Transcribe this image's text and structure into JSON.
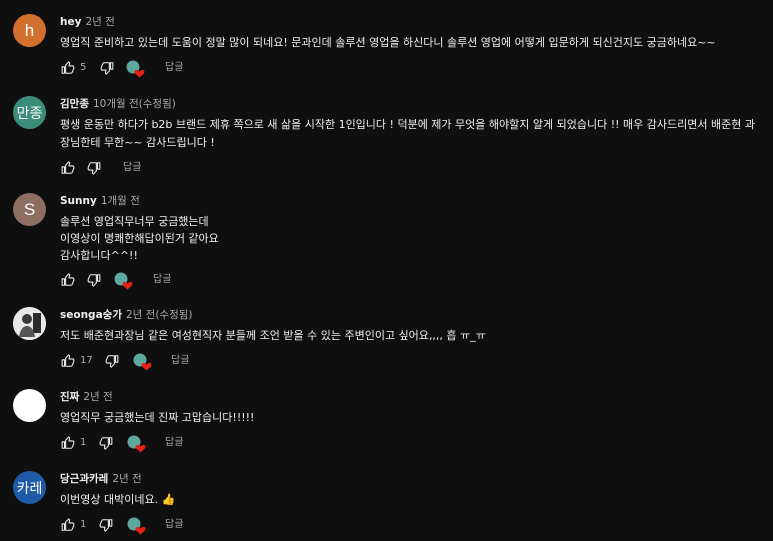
{
  "colors": {
    "background": "#0f0f0f",
    "text": "#f1f1f1",
    "muted": "#aaaaaa",
    "heart": "#e62117"
  },
  "comments": [
    {
      "avatar": {
        "text": "h",
        "color": "#d2712f"
      },
      "author": "hey",
      "time": "2년 전",
      "text": "영업직 준비하고 있는데 도움이 정말 많이 되네요! 문과인데 솔루션 영업을 하신다니 솔루션 영업에 어떻게 입문하게 되신건지도 궁금하네요~~",
      "likes": "5",
      "reply_label": "답글"
    },
    {
      "avatar": {
        "text": "만종",
        "color": "#3c8c7a"
      },
      "author": "김만종",
      "time": "10개월 전(수정됨)",
      "text": "평생 운동만 하다가 b2b 브랜드 제휴 쪽으로 새 삶을 시작한 1인입니다 !  덕분에 제가 무엇을 해야할지 알게 되었습니다 !! 매우 감사드리면서 배준현 과장님한테 무한~~ 감사드립니다 !",
      "likes": "",
      "reply_label": "답글"
    },
    {
      "avatar": {
        "text": "S",
        "color": "#8d6e63"
      },
      "author": "Sunny",
      "time": "1개월 전",
      "text": "솔루션 영업직무너무 궁금했는데\n이영상이 명쾌한해답이된거 같아요\n감사합니다^^!!",
      "likes": "",
      "reply_label": "답글"
    },
    {
      "avatar": {
        "text": "",
        "color": "#d9d9d9"
      },
      "author": "seonga숭가",
      "time": "2년 전(수정됨)",
      "text": "저도 배준현과장님 같은 여성현직자 분들께 조언 받을 수 있는 주변인이고 싶어요,,,, 흡 ㅠ_ㅠ",
      "likes": "17",
      "reply_label": "답글"
    },
    {
      "avatar": {
        "text": "",
        "color": "#ffffff"
      },
      "author": "진짜",
      "time": "2년 전",
      "text": "영업직무 궁금했는데 진짜 고맙습니다!!!!!",
      "likes": "1",
      "reply_label": "답글"
    },
    {
      "avatar": {
        "text": "카레",
        "color": "#1f5aa6"
      },
      "author": "당근과카레",
      "time": "2년 전",
      "text": "이번영상 대박이네요. 👍",
      "likes": "1",
      "reply_label": "답글"
    }
  ]
}
